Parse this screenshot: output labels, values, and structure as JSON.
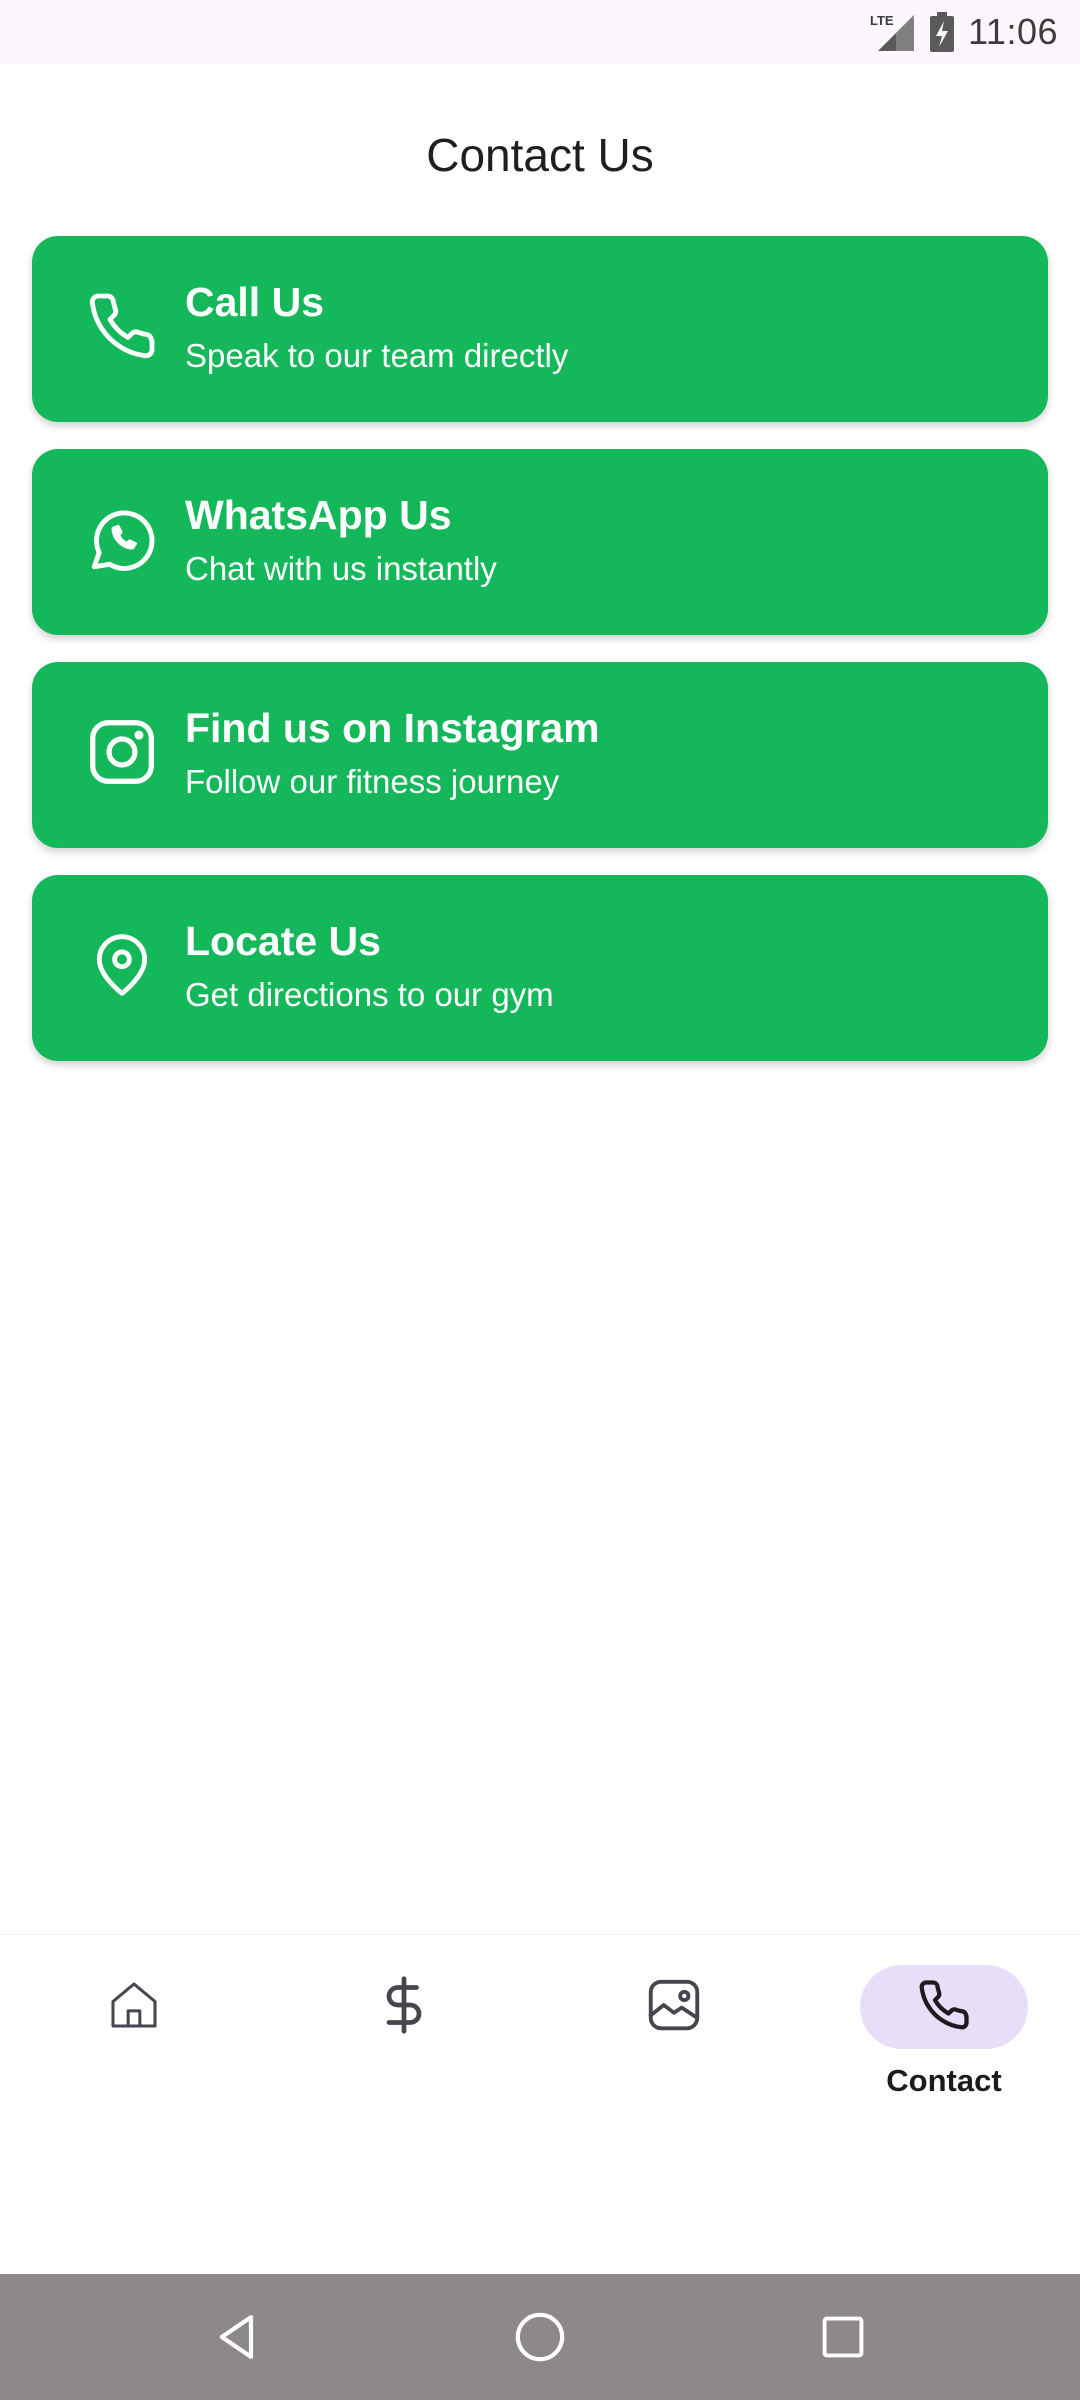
{
  "status_bar": {
    "time": "11:06",
    "network_label": "LTE",
    "icons": [
      "lte-signal-icon",
      "battery-charging-icon"
    ]
  },
  "page": {
    "title": "Contact Us"
  },
  "contact_options": [
    {
      "icon": "phone-icon",
      "title": "Call Us",
      "subtitle": "Speak to our team directly"
    },
    {
      "icon": "whatsapp-icon",
      "title": "WhatsApp Us",
      "subtitle": "Chat with us instantly"
    },
    {
      "icon": "instagram-icon",
      "title": "Find us on Instagram",
      "subtitle": "Follow our fitness journey"
    },
    {
      "icon": "map-pin-icon",
      "title": "Locate Us",
      "subtitle": "Get directions to our gym"
    }
  ],
  "bottom_nav": {
    "items": [
      {
        "icon": "home-icon",
        "label": ""
      },
      {
        "icon": "dollar-icon",
        "label": ""
      },
      {
        "icon": "gallery-icon",
        "label": ""
      },
      {
        "icon": "phone-icon",
        "label": "Contact",
        "active": true
      }
    ]
  },
  "system_nav": {
    "buttons": [
      "back-triangle-icon",
      "home-circle-icon",
      "recents-square-icon"
    ]
  },
  "colors": {
    "card_green": "#14b85a",
    "status_bar_bg": "#fdf6fd",
    "active_pill": "#e8def7",
    "system_nav_bg": "#8c888c"
  }
}
